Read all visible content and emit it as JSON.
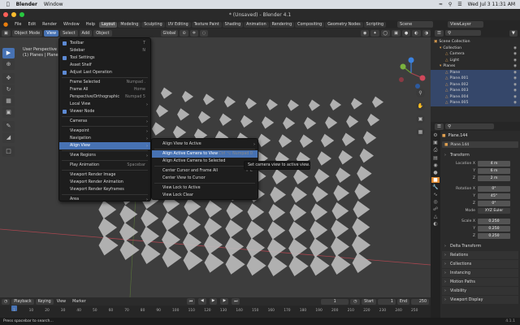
{
  "macbar": {
    "apple": "",
    "app_name": "Blender",
    "window_menu": "Window",
    "datetime": "Wed Jul 3  11:31 AM"
  },
  "titlebar": {
    "title": "* (Unsaved) - Blender 4.1"
  },
  "topbar": {
    "menus": [
      "File",
      "Edit",
      "Render",
      "Window",
      "Help"
    ],
    "workspaces": [
      "Layout",
      "Modeling",
      "Sculpting",
      "UV Editing",
      "Texture Paint",
      "Shading",
      "Animation",
      "Rendering",
      "Compositing",
      "Geometry Nodes",
      "Scripting"
    ],
    "active_workspace": "Layout",
    "scene": "Scene",
    "view_layer": "ViewLayer"
  },
  "viewport_header": {
    "mode": "Object Mode",
    "menus": [
      "View",
      "Select",
      "Add",
      "Object"
    ],
    "orientation": "Global",
    "options": "Options"
  },
  "viewport_info": {
    "line1": "User Perspective",
    "line2": "(1) Planes | Plane.144"
  },
  "view_menu": {
    "items": [
      {
        "label": "Toolbar",
        "shortcut": "T",
        "check": true
      },
      {
        "label": "Sidebar",
        "shortcut": "N",
        "check": false
      },
      {
        "label": "Tool Settings",
        "shortcut": "",
        "check": true
      },
      {
        "label": "Asset Shelf",
        "shortcut": "",
        "check": false
      },
      {
        "label": "Adjust Last Operation",
        "shortcut": "",
        "check": true
      },
      {
        "sep": true
      },
      {
        "label": "Frame Selected",
        "shortcut": "Numpad ."
      },
      {
        "label": "Frame All",
        "shortcut": "Home"
      },
      {
        "label": "Perspective/Orthographic",
        "shortcut": "Numpad 5"
      },
      {
        "label": "Local View",
        "sub": true
      },
      {
        "label": "Viewer Node",
        "shortcut": "",
        "check": true
      },
      {
        "sep": true
      },
      {
        "label": "Cameras",
        "sub": true
      },
      {
        "sep": true
      },
      {
        "label": "Viewpoint",
        "sub": true
      },
      {
        "label": "Navigation",
        "sub": true
      },
      {
        "label": "Align View",
        "sub": true,
        "hl": true
      },
      {
        "sep": true
      },
      {
        "label": "View Regions",
        "sub": true
      },
      {
        "sep": true
      },
      {
        "label": "Play Animation",
        "shortcut": "Spacebar"
      },
      {
        "sep": true
      },
      {
        "label": "Viewport Render Image"
      },
      {
        "label": "Viewport Render Animation"
      },
      {
        "label": "Viewport Render Keyframes"
      },
      {
        "sep": true
      },
      {
        "label": "Area",
        "sub": true
      }
    ]
  },
  "align_menu": {
    "items": [
      {
        "label": "Align View to Active",
        "sub": true
      },
      {
        "sep": true
      },
      {
        "label": "Align Active Camera to View",
        "shortcut": "Ctrl ⌥ Numpad 0",
        "hl": true
      },
      {
        "label": "Align Active Camera to Selected"
      },
      {
        "sep": true
      },
      {
        "label": "Center Cursor and Frame All",
        "shortcut": "⇧ C"
      },
      {
        "label": "Center View to Cursor"
      },
      {
        "sep": true
      },
      {
        "label": "View Lock to Active"
      },
      {
        "label": "View Lock Clear"
      }
    ]
  },
  "tooltip": "Set camera view to active view.",
  "outliner": {
    "search_placeholder": "",
    "items": [
      {
        "label": "Scene Collection",
        "indent": 0
      },
      {
        "label": "Collection",
        "indent": 1
      },
      {
        "label": "Camera",
        "indent": 2
      },
      {
        "label": "Light",
        "indent": 2
      },
      {
        "label": "Planes",
        "indent": 1
      },
      {
        "label": "Plane",
        "indent": 2
      },
      {
        "label": "Plane.001",
        "indent": 2
      },
      {
        "label": "Plane.002",
        "indent": 2
      },
      {
        "label": "Plane.003",
        "indent": 2
      },
      {
        "label": "Plane.004",
        "indent": 2
      },
      {
        "label": "Plane.005",
        "indent": 2
      }
    ]
  },
  "properties": {
    "object_name": "Plane.144",
    "object_field": "Plane.144",
    "transform_title": "Transform",
    "location_label": "Location X",
    "location": [
      "4 m",
      "6 m",
      "2 m"
    ],
    "rotation_label": "Rotation X",
    "rotation": [
      "0°",
      "45°",
      "0°"
    ],
    "mode_label": "Mode",
    "mode_value": "XYZ Euler",
    "scale_label": "Scale X",
    "scale": [
      "0.250",
      "0.250",
      "0.250"
    ],
    "axis_y": "Y",
    "axis_z": "Z",
    "delta": "Delta Transform",
    "sections": [
      "Relations",
      "Collections",
      "Instancing",
      "Motion Paths",
      "Visibility",
      "Viewport Display"
    ]
  },
  "timeline": {
    "menus": [
      "Playback",
      "Keying",
      "View",
      "Marker"
    ],
    "current_frame": "1",
    "start_label": "Start",
    "start": "1",
    "end_label": "End",
    "end": "250",
    "ticks": [
      "1",
      "10",
      "20",
      "30",
      "40",
      "50",
      "60",
      "70",
      "80",
      "90",
      "100",
      "110",
      "120",
      "130",
      "140",
      "150",
      "160",
      "170",
      "180",
      "190",
      "200",
      "210",
      "220",
      "230",
      "240",
      "250"
    ]
  },
  "status": {
    "text": "Press spacebar to search...",
    "version": "4.1.1"
  },
  "colors": {
    "accent": "#4772b3",
    "x_axis": "#a8464f",
    "y_axis": "#6a9a35",
    "gizmo_z": "#3b82e0"
  }
}
